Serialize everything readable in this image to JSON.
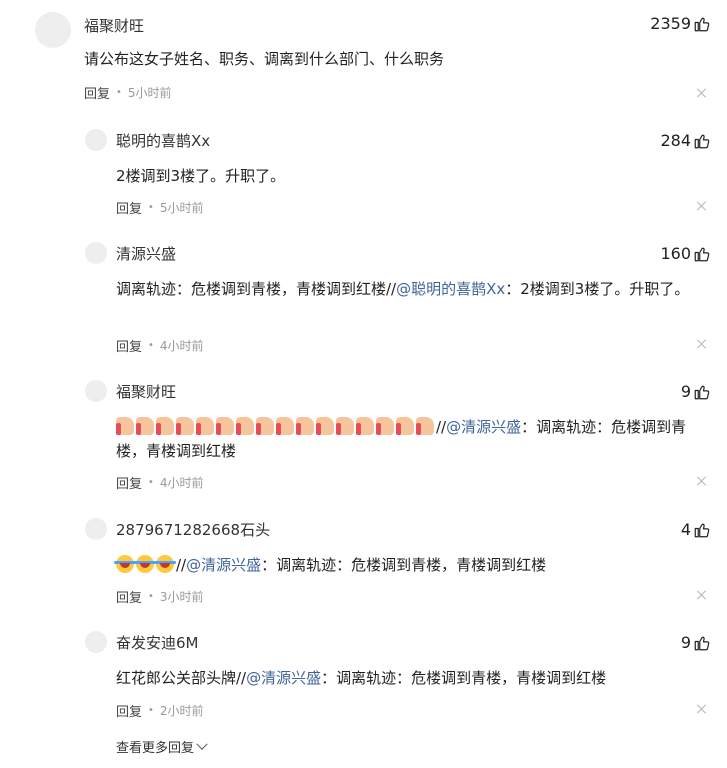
{
  "top_comment": {
    "username": "福聚财旺",
    "likes": "2359",
    "content": "请公布这女子姓名、职务、调离到什么部门、什么职务",
    "reply_label": "回复",
    "time": "5小时前"
  },
  "replies": [
    {
      "username": "聪明的喜鹊Xx",
      "likes": "284",
      "content": "2楼调到3楼了。升职了。",
      "reply_label": "回复",
      "time": "5小时前"
    },
    {
      "username": "清源兴盛",
      "likes": "160",
      "content_prefix": "调离轨迹：危楼调到青楼，青楼调到红楼//",
      "mention": "@聪明的喜鹊Xx",
      "content_suffix": "：2楼调到3楼了。升职了。",
      "reply_label": "回复",
      "time": "4小时前"
    },
    {
      "username": "福聚财旺",
      "likes": "9",
      "emoji_count": 16,
      "emoji_name": "thumbs-up-emoji",
      "content_prefix": "//",
      "mention": "@清源兴盛",
      "content_suffix": "：调离轨迹：危楼调到青楼，青楼调到红楼",
      "reply_label": "回复",
      "time": "4小时前"
    },
    {
      "username": "2879671282668石头",
      "likes": "4",
      "emoji_count": 3,
      "emoji_name": "laughing-emoji",
      "content_prefix": "//",
      "mention": "@清源兴盛",
      "content_suffix": "：调离轨迹：危楼调到青楼，青楼调到红楼",
      "reply_label": "回复",
      "time": "3小时前"
    },
    {
      "username": "奋发安迪6M",
      "likes": "9",
      "content_prefix": "红花郎公关部头牌//",
      "mention": "@清源兴盛",
      "content_suffix": "：调离轨迹：危楼调到青楼，青楼调到红楼",
      "reply_label": "回复",
      "time": "2小时前"
    }
  ],
  "view_more_label": "查看更多回复",
  "colors": {
    "mention": "#406599",
    "meta": "#999999",
    "text": "#222222"
  }
}
